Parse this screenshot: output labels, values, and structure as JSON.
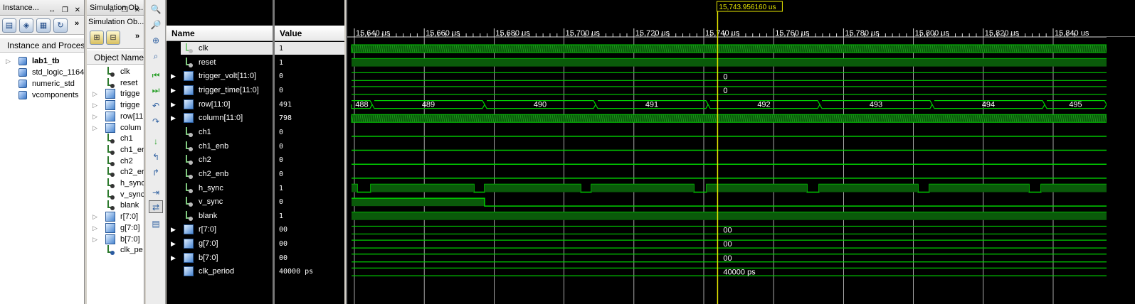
{
  "instance_panel": {
    "title": "Instance...",
    "section_title": "Instance and Process",
    "tree": [
      {
        "label": "lab1_tb",
        "bold": true,
        "expander": true
      },
      {
        "label": "std_logic_1164",
        "bold": false,
        "expander": false
      },
      {
        "label": "numeric_std",
        "bold": false,
        "expander": false
      },
      {
        "label": "vcomponents",
        "bold": false,
        "expander": false
      }
    ]
  },
  "object_panel": {
    "title": "Simulation Ob...",
    "column_title": "Object Name",
    "items": [
      {
        "label": "clk",
        "kind": "signal",
        "expander": false
      },
      {
        "label": "reset",
        "kind": "signal",
        "expander": false
      },
      {
        "label": "trigge",
        "kind": "bus",
        "expander": true
      },
      {
        "label": "trigge",
        "kind": "bus",
        "expander": true
      },
      {
        "label": "row[11",
        "kind": "bus",
        "expander": true
      },
      {
        "label": "colum",
        "kind": "bus",
        "expander": true
      },
      {
        "label": "ch1",
        "kind": "signal",
        "expander": false
      },
      {
        "label": "ch1_er",
        "kind": "signal",
        "expander": false
      },
      {
        "label": "ch2",
        "kind": "signal",
        "expander": false
      },
      {
        "label": "ch2_er",
        "kind": "signal",
        "expander": false
      },
      {
        "label": "h_sync",
        "kind": "signal",
        "expander": false
      },
      {
        "label": "v_sync",
        "kind": "signal",
        "expander": false
      },
      {
        "label": "blank",
        "kind": "signal",
        "expander": false
      },
      {
        "label": "r[7:0]",
        "kind": "bus",
        "expander": true
      },
      {
        "label": "g[7:0]",
        "kind": "bus",
        "expander": true
      },
      {
        "label": "b[7:0]",
        "kind": "bus",
        "expander": true
      },
      {
        "label": "clk_pe",
        "kind": "constant",
        "expander": false
      }
    ]
  },
  "vertical_toolbar": {
    "icons": [
      "zoom-in-icon",
      "zoom-out-icon",
      "zoom-fit-icon",
      "zoom-area-icon",
      "go-start-icon",
      "go-end-icon",
      "prev-transition-icon",
      "next-transition-icon",
      "add-marker-icon",
      "prev-marker-icon",
      "next-marker-icon",
      "snap-icon",
      "swap-cursors-icon",
      "grid-icon"
    ]
  },
  "waveform": {
    "name_header": "Name",
    "value_header": "Value",
    "cursor_label": "15,743.956160 us",
    "time_ticks": [
      "15,640 us",
      "15,660 us",
      "15,680 us",
      "15,700 us",
      "15,720 us",
      "15,740 us",
      "15,760 us",
      "15,780 us",
      "15,800 us",
      "15,820 us",
      "15,840 us"
    ],
    "signals": [
      {
        "name": "clk",
        "value": "1",
        "type": "clock",
        "expander": false
      },
      {
        "name": "reset",
        "value": "1",
        "type": "high",
        "expander": false
      },
      {
        "name": "trigger_volt[11:0]",
        "value": "0",
        "type": "bus-const",
        "bus_text": "0",
        "expander": true
      },
      {
        "name": "trigger_time[11:0]",
        "value": "0",
        "type": "bus-const",
        "bus_text": "0",
        "expander": true
      },
      {
        "name": "row[11:0]",
        "value": "491",
        "type": "bus-row",
        "expander": true
      },
      {
        "name": "column[11:0]",
        "value": "798",
        "type": "bus-fast",
        "expander": true
      },
      {
        "name": "ch1",
        "value": "0",
        "type": "low",
        "expander": false
      },
      {
        "name": "ch1_enb",
        "value": "0",
        "type": "low",
        "expander": false
      },
      {
        "name": "ch2",
        "value": "0",
        "type": "low",
        "expander": false
      },
      {
        "name": "ch2_enb",
        "value": "0",
        "type": "low",
        "expander": false
      },
      {
        "name": "h_sync",
        "value": "1",
        "type": "hsync",
        "expander": false
      },
      {
        "name": "v_sync",
        "value": "0",
        "type": "vsync",
        "expander": false
      },
      {
        "name": "blank",
        "value": "1",
        "type": "high",
        "expander": false
      },
      {
        "name": "r[7:0]",
        "value": "00",
        "type": "bus-const",
        "bus_text": "00",
        "expander": true
      },
      {
        "name": "g[7:0]",
        "value": "00",
        "type": "bus-const",
        "bus_text": "00",
        "expander": true
      },
      {
        "name": "b[7:0]",
        "value": "00",
        "type": "bus-const",
        "bus_text": "00",
        "expander": true
      },
      {
        "name": "clk_period",
        "value": "40000 ps",
        "type": "bus-const",
        "bus_text": "40000 ps",
        "expander": false
      }
    ],
    "row_segments": [
      "488",
      "489",
      "490",
      "491",
      "492",
      "493",
      "494",
      "495"
    ],
    "colors": {
      "wave": "#00d000",
      "bus_fill": "#0a5a0a",
      "cursor": "#e8e800",
      "grid": "#cfcfcf"
    }
  }
}
